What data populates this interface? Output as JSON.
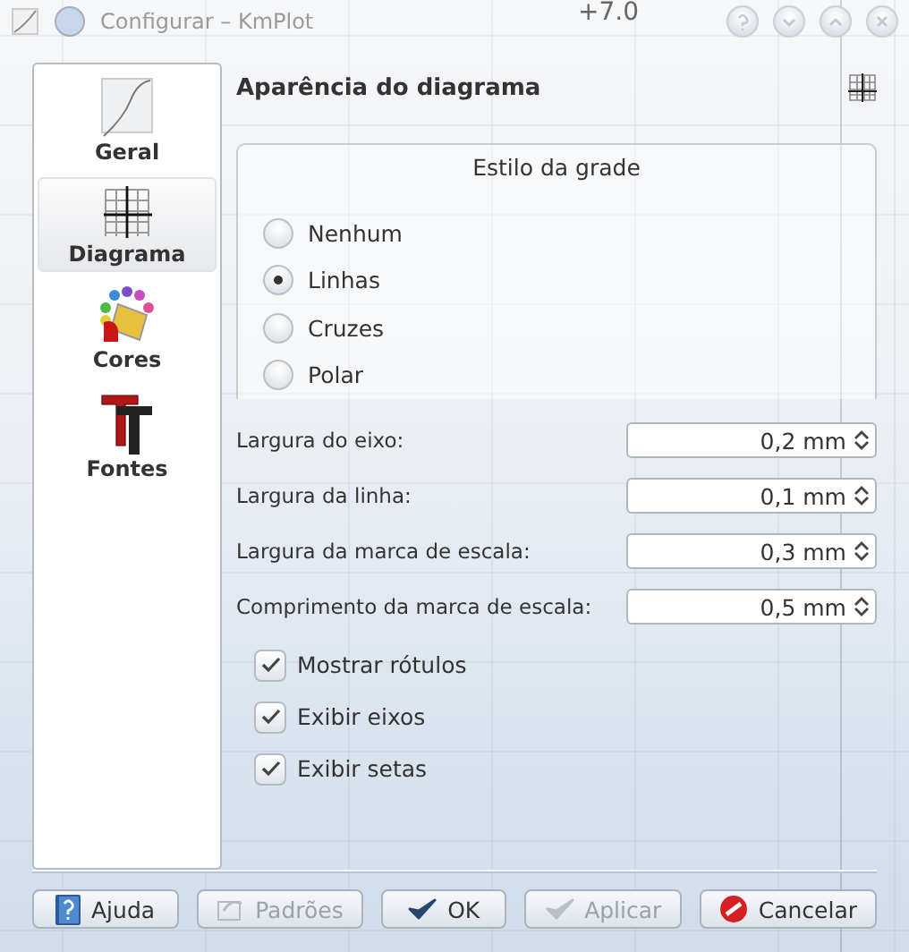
{
  "window": {
    "title": "Configurar – KmPlot",
    "controls": [
      {
        "kind": "help"
      },
      {
        "kind": "minimize"
      },
      {
        "kind": "maximize"
      },
      {
        "kind": "close"
      }
    ]
  },
  "background_plot": {
    "labels": [
      "+7.0"
    ]
  },
  "sidebar": {
    "items": [
      {
        "label": "Geral",
        "kind": "plot",
        "selected": false
      },
      {
        "label": "Diagrama",
        "kind": "grid",
        "selected": true
      },
      {
        "label": "Cores",
        "kind": "colors",
        "selected": false
      },
      {
        "label": "Fontes",
        "kind": "fonts",
        "selected": false
      }
    ]
  },
  "page": {
    "title": "Aparência do diagrama"
  },
  "grid_style": {
    "title": "Estilo da grade",
    "options": [
      {
        "label": "Nenhum",
        "selected": false
      },
      {
        "label": "Linhas",
        "selected": true
      },
      {
        "label": "Cruzes",
        "selected": false
      },
      {
        "label": "Polar",
        "selected": false
      }
    ]
  },
  "fields": [
    {
      "label": "Largura do eixo:",
      "value": "0,2 mm"
    },
    {
      "label": "Largura da linha:",
      "value": "0,1 mm"
    },
    {
      "label": "Largura da marca de escala:",
      "value": "0,3 mm"
    },
    {
      "label": "Comprimento da marca de escala:",
      "value": "0,5 mm"
    }
  ],
  "checkboxes": [
    {
      "label": "Mostrar rótulos",
      "checked": true
    },
    {
      "label": "Exibir eixos",
      "checked": true
    },
    {
      "label": "Exibir setas",
      "checked": true
    }
  ],
  "buttons": [
    {
      "label": "Ajuda",
      "kind": "help",
      "disabled": false
    },
    {
      "label": "Padrões",
      "kind": "defaults",
      "disabled": true
    },
    {
      "label": "OK",
      "kind": "ok",
      "disabled": false
    },
    {
      "label": "Aplicar",
      "kind": "apply",
      "disabled": true
    },
    {
      "label": "Cancelar",
      "kind": "cancel",
      "disabled": false
    }
  ]
}
